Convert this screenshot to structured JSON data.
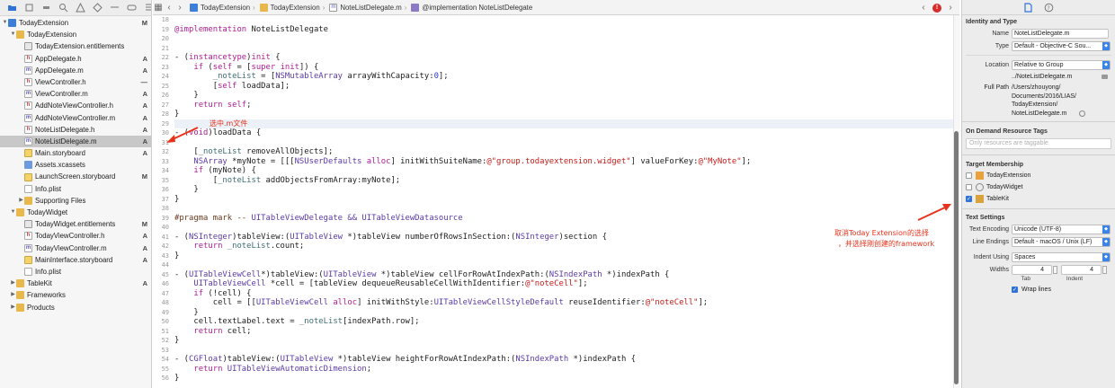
{
  "jumpbar": {
    "crumbs": [
      "TodayExtension",
      "TodayExtension",
      "NoteListDelegate.m",
      "@implementation NoteListDelegate"
    ]
  },
  "navigator": {
    "items": [
      {
        "label": "TodayExtension",
        "status": "M",
        "depth": 0,
        "icon": "project",
        "disclosure": "open"
      },
      {
        "label": "TodayExtension",
        "status": "",
        "depth": 1,
        "icon": "folder",
        "disclosure": "open"
      },
      {
        "label": "TodayExtension.entitlements",
        "status": "",
        "depth": 2,
        "icon": "ent"
      },
      {
        "label": "AppDelegate.h",
        "status": "A",
        "depth": 2,
        "icon": "h"
      },
      {
        "label": "AppDelegate.m",
        "status": "A",
        "depth": 2,
        "icon": "m"
      },
      {
        "label": "ViewController.h",
        "status": "—",
        "depth": 2,
        "icon": "h"
      },
      {
        "label": "ViewController.m",
        "status": "A",
        "depth": 2,
        "icon": "m"
      },
      {
        "label": "AddNoteViewController.h",
        "status": "A",
        "depth": 2,
        "icon": "h"
      },
      {
        "label": "AddNoteViewController.m",
        "status": "A",
        "depth": 2,
        "icon": "m"
      },
      {
        "label": "NoteListDelegate.h",
        "status": "A",
        "depth": 2,
        "icon": "h"
      },
      {
        "label": "NoteListDelegate.m",
        "status": "A",
        "depth": 2,
        "icon": "m",
        "selected": true
      },
      {
        "label": "Main.storyboard",
        "status": "A",
        "depth": 2,
        "icon": "sb"
      },
      {
        "label": "Assets.xcassets",
        "status": "",
        "depth": 2,
        "icon": "assets"
      },
      {
        "label": "LaunchScreen.storyboard",
        "status": "M",
        "depth": 2,
        "icon": "sb"
      },
      {
        "label": "Info.plist",
        "status": "",
        "depth": 2,
        "icon": "plist"
      },
      {
        "label": "Supporting Files",
        "status": "",
        "depth": 2,
        "icon": "folder",
        "disclosure": "closed"
      },
      {
        "label": "TodayWidget",
        "status": "",
        "depth": 1,
        "icon": "folder",
        "disclosure": "open"
      },
      {
        "label": "TodayWidget.entitlements",
        "status": "M",
        "depth": 2,
        "icon": "ent"
      },
      {
        "label": "TodayViewController.h",
        "status": "A",
        "depth": 2,
        "icon": "h"
      },
      {
        "label": "TodayViewController.m",
        "status": "A",
        "depth": 2,
        "icon": "m"
      },
      {
        "label": "MainInterface.storyboard",
        "status": "A",
        "depth": 2,
        "icon": "sb"
      },
      {
        "label": "Info.plist",
        "status": "",
        "depth": 2,
        "icon": "plist"
      },
      {
        "label": "TableKit",
        "status": "A",
        "depth": 1,
        "icon": "folder",
        "disclosure": "closed"
      },
      {
        "label": "Frameworks",
        "status": "",
        "depth": 1,
        "icon": "folder",
        "disclosure": "closed"
      },
      {
        "label": "Products",
        "status": "",
        "depth": 1,
        "icon": "folder",
        "disclosure": "closed"
      }
    ]
  },
  "editor": {
    "line_numbers": [
      "18",
      "19",
      "20",
      "21",
      "22",
      "23",
      "24",
      "25",
      "26",
      "27",
      "28",
      "29",
      "30",
      "31",
      "32",
      "33",
      "34",
      "35",
      "36",
      "37",
      "38",
      "39",
      "40",
      "41",
      "42",
      "43",
      "44",
      "45",
      "46",
      "47",
      "48",
      "49",
      "50",
      "51",
      "52",
      "53",
      "54",
      "55",
      "56"
    ],
    "current_line_index": 11,
    "lines": [
      "",
      "@implementation NoteListDelegate",
      "",
      "",
      "- (instancetype)init {",
      "    if (self = [super init]) {",
      "        _noteList = [NSMutableArray arrayWithCapacity:0];",
      "        [self loadData];",
      "    }",
      "    return self;",
      "}",
      "",
      "- (void)loadData {",
      "",
      "    [_noteList removeAllObjects];",
      "    NSArray *myNote = [[[NSUserDefaults alloc] initWithSuiteName:@\"group.todayextension.widget\"] valueForKey:@\"MyNote\"];",
      "    if (myNote) {",
      "        [_noteList addObjectsFromArray:myNote];",
      "    }",
      "}",
      "",
      "#pragma mark -- UITableViewDelegate && UITableViewDatasource",
      "",
      "- (NSInteger)tableView:(UITableView *)tableView numberOfRowsInSection:(NSInteger)section {",
      "    return _noteList.count;",
      "}",
      "",
      "- (UITableViewCell*)tableView:(UITableView *)tableView cellForRowAtIndexPath:(NSIndexPath *)indexPath {",
      "    UITableViewCell *cell = [tableView dequeueReusableCellWithIdentifier:@\"noteCell\"];",
      "    if (!cell) {",
      "        cell = [[UITableViewCell alloc] initWithStyle:UITableViewCellStyleDefault reuseIdentifier:@\"noteCell\"];",
      "    }",
      "    cell.textLabel.text = _noteList[indexPath.row];",
      "    return cell;",
      "}",
      "",
      "- (CGFloat)tableView:(UITableView *)tableView heightForRowAtIndexPath:(NSIndexPath *)indexPath {",
      "    return UITableViewAutomaticDimension;",
      "}"
    ]
  },
  "annotations": {
    "select_file": "选中.m文件",
    "uncheck_line1": "取消Today Extension的选择",
    "uncheck_line2": "，并选择刚创建的framework"
  },
  "inspector": {
    "identity_header": "Identity and Type",
    "name_label": "Name",
    "name_value": "NoteListDelegate.m",
    "type_label": "Type",
    "type_value": "Default - Objective-C Sou...",
    "location_label": "Location",
    "location_value": "Relative to Group",
    "location_path": "../NoteListDelegate.m",
    "fullpath_label": "Full Path",
    "fullpath_lines": [
      "/Users/zhouyong/",
      "Documents/2016/LIAS/",
      "TodayExtension/",
      "NoteListDelegate.m"
    ],
    "odr_header": "On Demand Resource Tags",
    "odr_placeholder": "Only resources are taggable",
    "tm_header": "Target Membership",
    "targets": [
      {
        "label": "TodayExtension",
        "checked": false,
        "icon": "app-target-icon"
      },
      {
        "label": "TodayWidget",
        "checked": false,
        "icon": "extension-target-icon"
      },
      {
        "label": "TableKit",
        "checked": true,
        "icon": "framework-target-icon"
      }
    ],
    "text_header": "Text Settings",
    "encoding_label": "Text Encoding",
    "encoding_value": "Unicode (UTF-8)",
    "endings_label": "Line Endings",
    "endings_value": "Default - macOS / Unix (LF)",
    "indent_label": "Indent Using",
    "indent_value": "Spaces",
    "widths_label": "Widths",
    "tab_value": "4",
    "indent_width_value": "4",
    "tab_label": "Tab",
    "indent_sub_label": "Indent",
    "wrap_label": "Wrap lines",
    "wrap_checked": true
  },
  "colors": {
    "accent": "#2f73d9",
    "annotation": "#e8331c"
  }
}
